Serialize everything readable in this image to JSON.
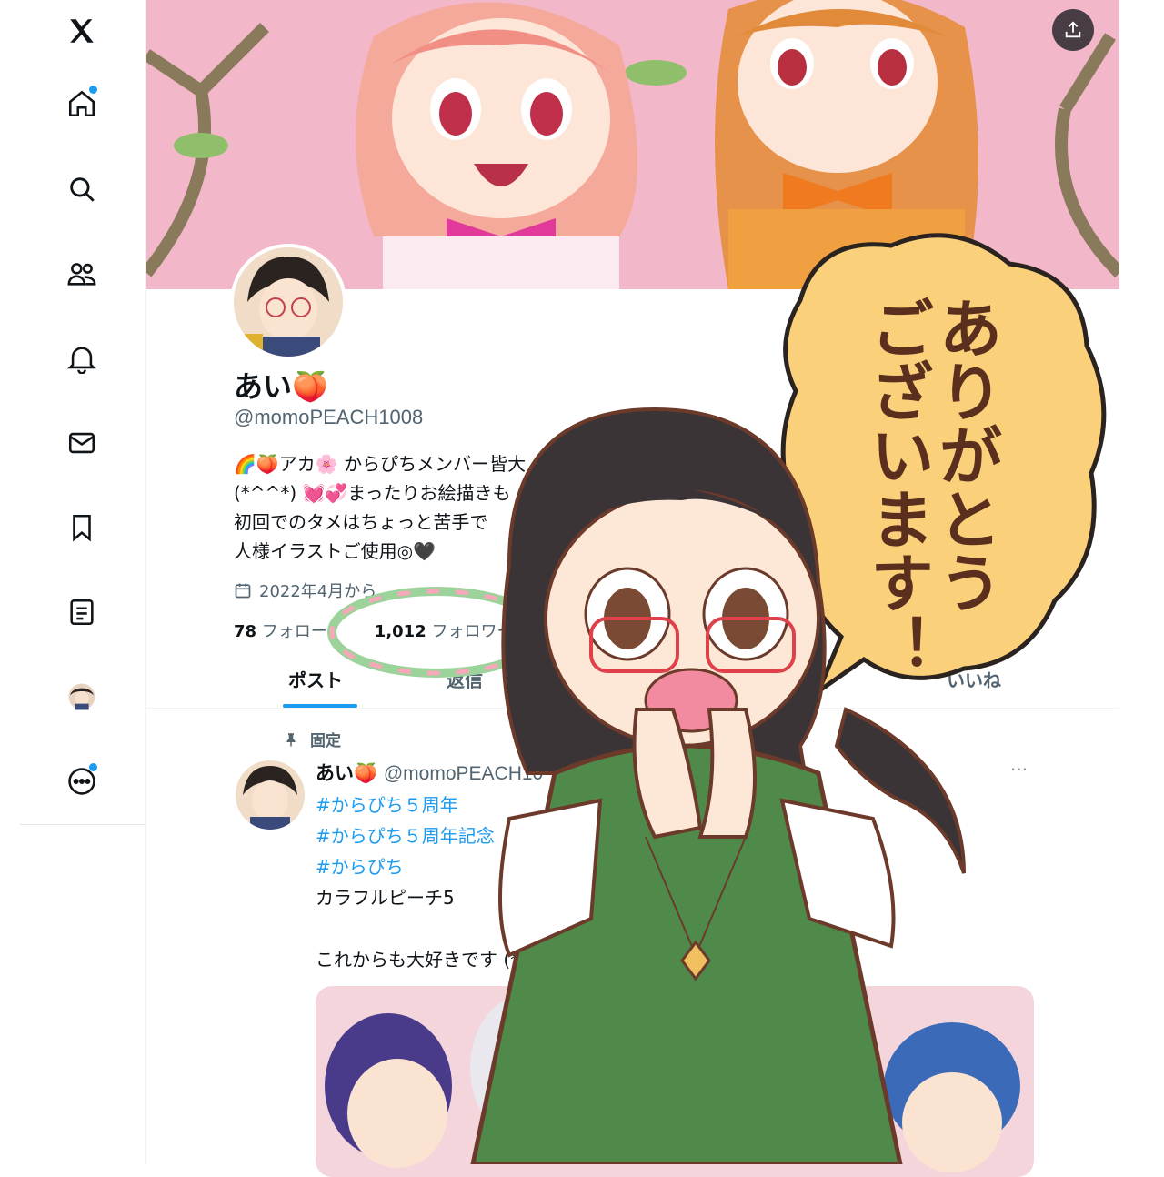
{
  "sidebar": {
    "logo": "x-logo",
    "items": [
      {
        "icon": "home-icon",
        "dot": true
      },
      {
        "icon": "search-icon",
        "dot": false
      },
      {
        "icon": "communities-icon",
        "dot": false
      },
      {
        "icon": "bell-icon",
        "dot": false
      },
      {
        "icon": "mail-icon",
        "dot": false
      },
      {
        "icon": "bookmark-icon",
        "dot": false
      },
      {
        "icon": "lists-icon",
        "dot": false
      },
      {
        "icon": "profile-avatar",
        "dot": false
      },
      {
        "icon": "more-circle-icon",
        "dot": true
      }
    ],
    "accent": "#1d9bf0"
  },
  "profile": {
    "name": "あい🍑",
    "handle": "@momoPEACH1008",
    "bio": [
      "🌈🍑アカ🌸 からぴちメンバー皆大",
      "(*^^*) 💓💞まったりお絵描きも",
      "初回でのタメはちょっと苦手で",
      "人様イラストご使用◎🖤"
    ],
    "joined": "2022年4月から",
    "following_count": "78",
    "following_label": "フォロー",
    "followers_count": "1,012",
    "followers_label": "フォロワー"
  },
  "tabs": [
    {
      "label": "ポスト",
      "active": true
    },
    {
      "label": "返信",
      "active": false
    },
    {
      "label": "いいね",
      "active": false
    }
  ],
  "pinned_post": {
    "pinned_label": "固定",
    "author_name": "あい🍑",
    "author_handle": "@momoPEACH10",
    "more": "···",
    "lines": [
      {
        "text": "#からぴち５周年",
        "hashtag": true
      },
      {
        "text": "#からぴち５周年記念",
        "hashtag": true
      },
      {
        "text": " #からぴち",
        "hashtag": true
      },
      {
        "text": "カラフルピーチ5",
        "hashtag": false
      },
      {
        "text": "",
        "hashtag": false
      },
      {
        "text": "これからも大好きです (*'∇'*)",
        "hashtag": false
      }
    ]
  },
  "overlay": {
    "speech_bubble": [
      "ありがとう",
      "ございます！"
    ]
  }
}
